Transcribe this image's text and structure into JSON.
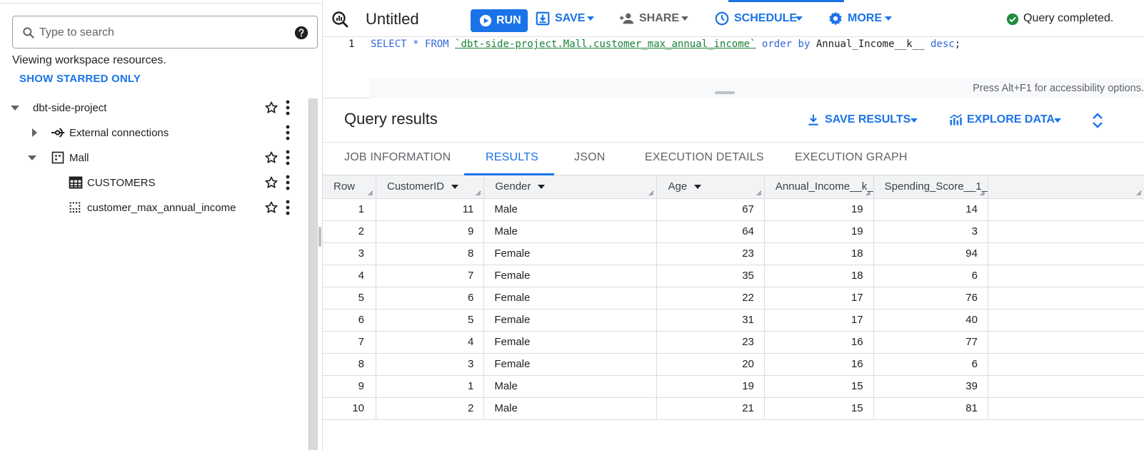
{
  "sidebar": {
    "search_placeholder": "Type to search",
    "viewing_text": "Viewing workspace resources.",
    "show_starred": "SHOW STARRED ONLY",
    "tree": [
      {
        "label": "dbt-side-project",
        "level": 0,
        "expanded": true,
        "icon": "none",
        "starred": false
      },
      {
        "label": "External connections",
        "level": 1,
        "expanded": false,
        "icon": "connection-icon",
        "starred": false
      },
      {
        "label": "Mall",
        "level": 1,
        "expanded": true,
        "icon": "dataset-icon",
        "starred": false
      },
      {
        "label": "CUSTOMERS",
        "level": 2,
        "icon": "table-icon",
        "starred": false
      },
      {
        "label": "customer_max_annual_income",
        "level": 2,
        "icon": "view-icon",
        "starred": false
      }
    ]
  },
  "toolbar": {
    "title": "Untitled",
    "run": "RUN",
    "save": "SAVE",
    "share": "SHARE",
    "schedule": "SCHEDULE",
    "more": "MORE",
    "status": "Query completed.",
    "accent": "#1a73e8",
    "success_color": "#1e8e3e"
  },
  "editor": {
    "line_number": "1",
    "tokens": {
      "select": "SELECT",
      "star": "*",
      "from": "FROM",
      "table": "`dbt-side-project.Mall.customer_max_annual_income`",
      "order": "order",
      "by": "by",
      "column": "Annual_Income__k__",
      "desc": "desc",
      "semicolon": ";"
    },
    "accessibility_hint": "Press Alt+F1 for accessibility options."
  },
  "results": {
    "title": "Query results",
    "save_results": "SAVE RESULTS",
    "explore_data": "EXPLORE DATA",
    "tabs": [
      {
        "label": "JOB INFORMATION",
        "active": false
      },
      {
        "label": "RESULTS",
        "active": true
      },
      {
        "label": "JSON",
        "active": false
      },
      {
        "label": "EXECUTION DETAILS",
        "active": false
      },
      {
        "label": "EXECUTION GRAPH",
        "active": false
      }
    ],
    "columns": [
      "Row",
      "CustomerID",
      "Gender",
      "Age",
      "Annual_Income__k_",
      "Spending_Score__1_"
    ],
    "rows": [
      [
        "1",
        "11",
        "Male",
        "67",
        "19",
        "14"
      ],
      [
        "2",
        "9",
        "Male",
        "64",
        "19",
        "3"
      ],
      [
        "3",
        "8",
        "Female",
        "23",
        "18",
        "94"
      ],
      [
        "4",
        "7",
        "Female",
        "35",
        "18",
        "6"
      ],
      [
        "5",
        "6",
        "Female",
        "22",
        "17",
        "76"
      ],
      [
        "6",
        "5",
        "Female",
        "31",
        "17",
        "40"
      ],
      [
        "7",
        "4",
        "Female",
        "23",
        "16",
        "77"
      ],
      [
        "8",
        "3",
        "Female",
        "20",
        "16",
        "6"
      ],
      [
        "9",
        "1",
        "Male",
        "19",
        "15",
        "39"
      ],
      [
        "10",
        "2",
        "Male",
        "21",
        "15",
        "81"
      ]
    ]
  }
}
